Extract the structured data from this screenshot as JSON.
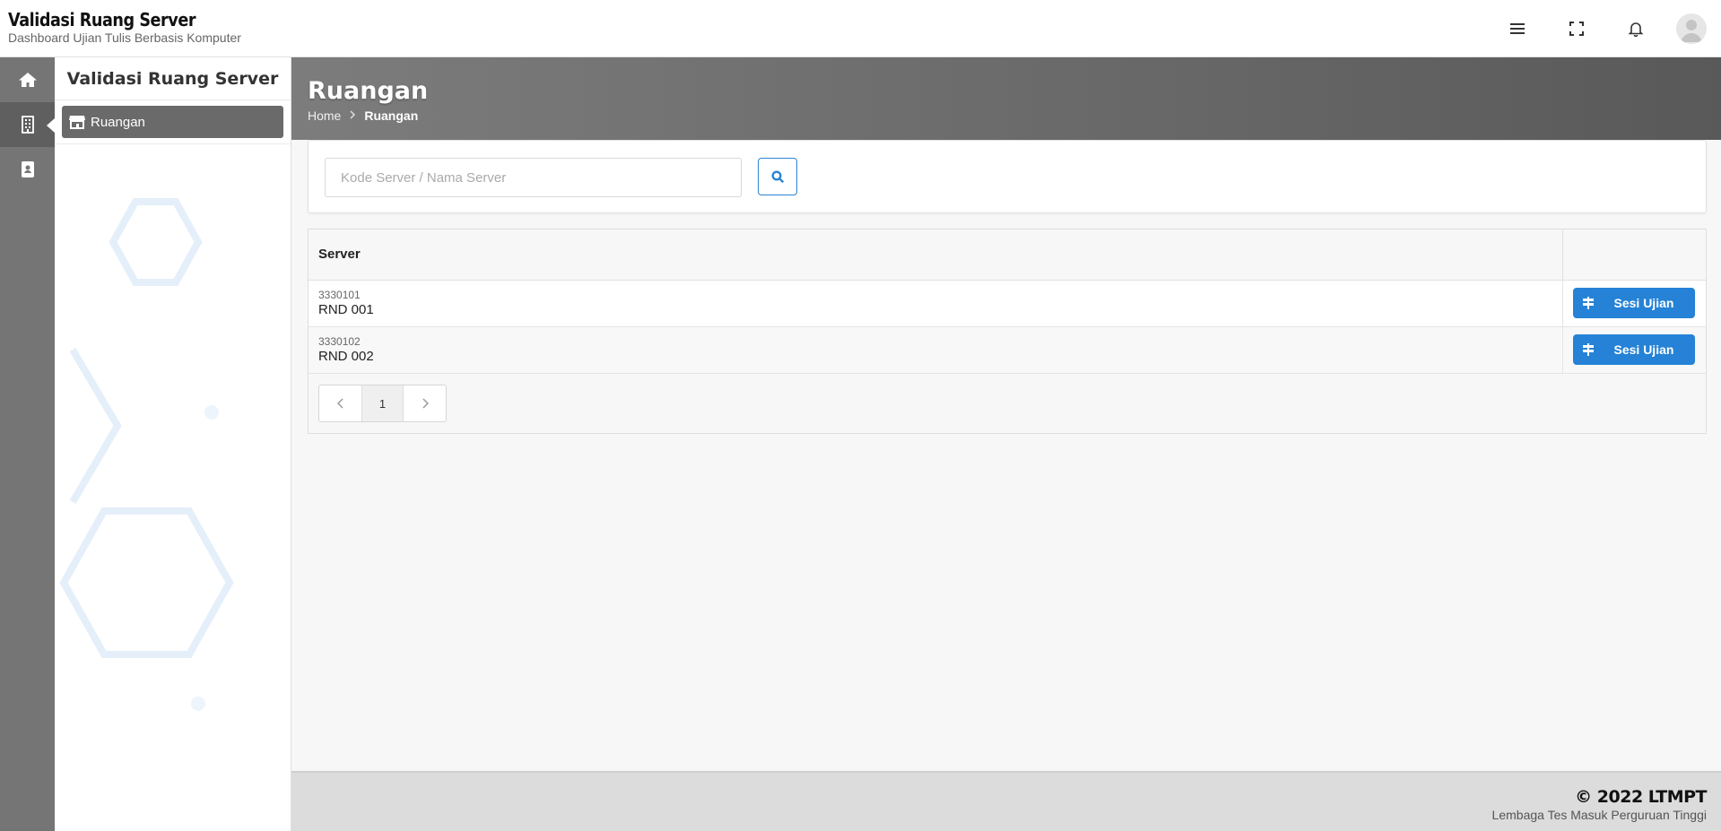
{
  "header": {
    "title": "Validasi Ruang Server",
    "subtitle": "Dashboard Ujian Tulis Berbasis Komputer"
  },
  "rail": {
    "items": [
      {
        "icon": "home-icon"
      },
      {
        "icon": "building-icon",
        "active": true
      },
      {
        "icon": "contact-book-icon"
      }
    ]
  },
  "subpanel": {
    "title": "Validasi Ruang Server",
    "items": [
      {
        "label": "Ruangan",
        "icon": "store-icon"
      }
    ]
  },
  "page": {
    "title": "Ruangan",
    "breadcrumb": {
      "home": "Home",
      "current": "Ruangan"
    }
  },
  "search": {
    "placeholder": "Kode Server / Nama Server",
    "value": ""
  },
  "table": {
    "columns": [
      "Server",
      ""
    ],
    "rows": [
      {
        "code": "3330101",
        "name": "RND 001",
        "action": "Sesi Ujian"
      },
      {
        "code": "3330102",
        "name": "RND 002",
        "action": "Sesi Ujian"
      }
    ]
  },
  "pagination": {
    "current_page": "1"
  },
  "footer": {
    "copyright": "© 2022 LTMPT",
    "org": "Lembaga Tes Masuk Perguruan Tinggi"
  },
  "colors": {
    "accent": "#2582d6",
    "rail": "#757575",
    "banner": "#686868"
  }
}
